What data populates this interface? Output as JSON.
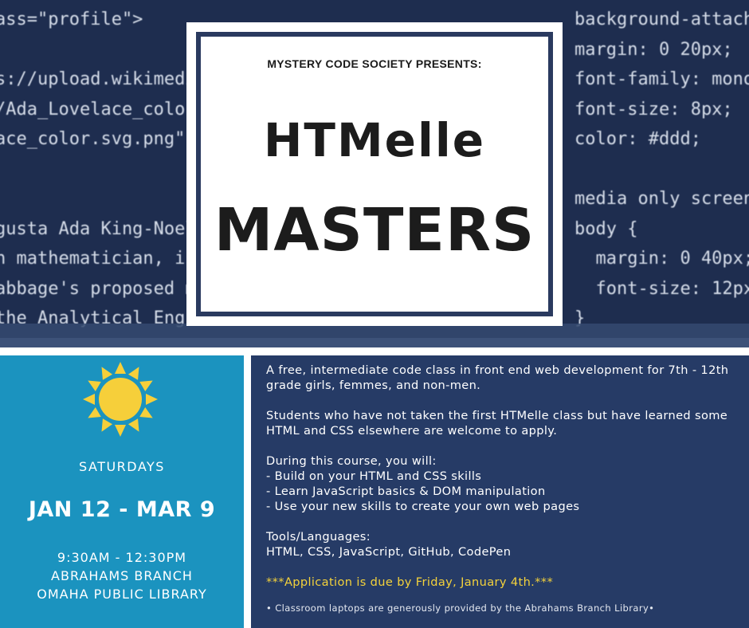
{
  "background_code": {
    "left_lines": [
      "ass=\"profile\">",
      "",
      "s://upload.wikimedia",
      "/Ada_Lovelace_color.",
      "ace_color.svg.png\" a",
      "",
      "",
      "gusta Ada King-Noel",
      "n mathematician, is",
      "abbage's proposed me",
      "the Analytical Eng    She was the first to"
    ],
    "right_lines": [
      "background-attach",
      "margin: 0 20px;",
      "font-family: mono",
      "font-size: 8px;",
      "color: #ddd;",
      "",
      "media only screen",
      "body {",
      "  margin: 0 40px;",
      "  font-size: 12px",
      "}"
    ]
  },
  "card": {
    "presents": "MYSTERY CODE SOCIETY PRESENTS:",
    "title_line1": "HTMelle",
    "title_line2": "MASTERS"
  },
  "schedule": {
    "icon": "sun-icon",
    "day": "SATURDAYS",
    "dates": "JAN 12 - MAR 9",
    "time": "9:30AM - 12:30PM",
    "branch": "ABRAHAMS BRANCH",
    "library": "OMAHA PUBLIC LIBRARY"
  },
  "description": {
    "intro": "A free, intermediate code class in front end web development for 7th - 12th grade girls, femmes, and non-men.",
    "eligibility": "Students who have not taken the first HTMelle class but have learned some HTML and CSS elsewhere are welcome to apply.",
    "course_heading": "During this course, you will:",
    "course_items": [
      "- Build on your HTML and CSS skills",
      "- Learn JavaScript basics & DOM manipulation",
      "- Use your new skills to create your own web pages"
    ],
    "tools_heading": "Tools/Languages:",
    "tools": "HTML, CSS, JavaScript, GitHub, CodePen",
    "deadline": "***Application is due by Friday, January 4th.***",
    "footnote": "• Classroom laptops are generously provided by the Abrahams Branch Library•"
  },
  "colors": {
    "banner": "#1e2d4f",
    "card_border": "#2a3a5f",
    "left_panel": "#1b93bf",
    "right_panel": "#263b66",
    "sun": "#f6cf3a",
    "deadline": "#f4d23b"
  }
}
